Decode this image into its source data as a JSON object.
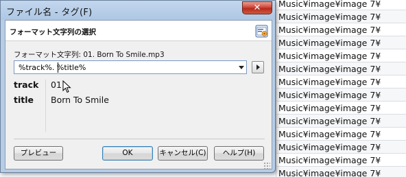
{
  "background": {
    "rows": [
      "Music¥image¥image 7¥",
      "Music¥image¥image 7¥",
      "Music¥image¥image 7¥",
      "Music¥image¥image 7¥",
      "Music¥image¥image 7¥",
      "Music¥image¥image 7¥",
      "Music¥image¥image 7¥",
      "Music¥image¥image 7¥",
      "Music¥image¥image 7¥",
      "Music¥image¥image 7¥",
      "Music¥image¥image 7¥",
      "Music¥image¥image 7¥",
      "Music¥image¥image 7¥",
      "Music¥image¥image 7¥"
    ]
  },
  "dialog": {
    "title": "ファイル名 - タグ(F)",
    "close_label": "✕",
    "header_title": "フォーマット文字列の選択",
    "header_icon": "format-settings-icon",
    "format_label": "フォーマット文字列: 01. Born To Smile.mp3",
    "format_value": "%track%. %title%",
    "preview": [
      {
        "key": "track",
        "value": "01"
      },
      {
        "key": "title",
        "value": "Born To Smile"
      }
    ],
    "buttons": {
      "preview": "プレビュー",
      "ok": "OK",
      "cancel": "キャンセル(C)",
      "help": "ヘルプ(H)"
    }
  },
  "colors": {
    "frame": "#b7cde6",
    "close": "#c8392b",
    "default_button_border": "#3c7fb1"
  }
}
